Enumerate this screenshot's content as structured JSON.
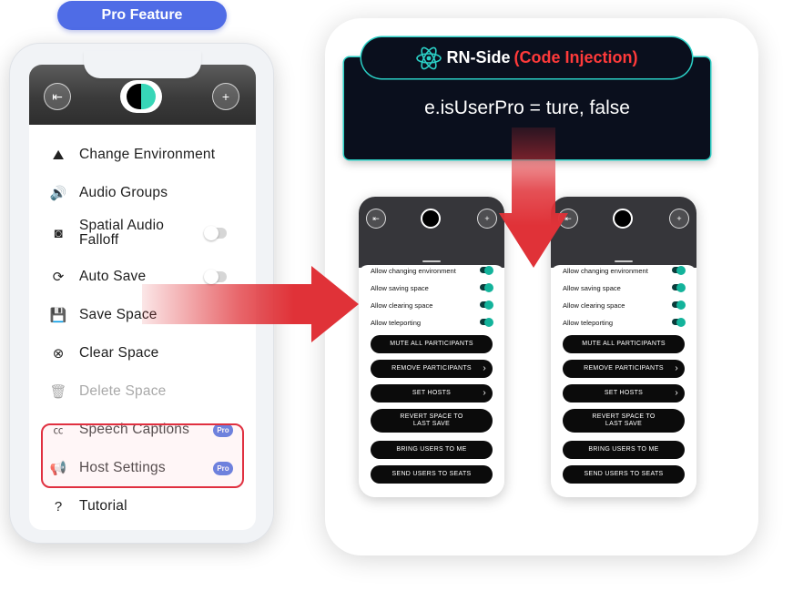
{
  "badge": {
    "label": "Pro Feature"
  },
  "left_phone": {
    "menu": [
      {
        "label": "Change Environment",
        "icon": "mountain-icon",
        "disabled": false
      },
      {
        "label": "Audio Groups",
        "icon": "speaker-icon",
        "disabled": false
      },
      {
        "label": "Spatial Audio Falloff",
        "icon": "spatial-audio-icon",
        "disabled": false,
        "toggle": "off"
      },
      {
        "label": "Auto Save",
        "icon": "auto-save-icon",
        "disabled": false,
        "toggle": "off"
      },
      {
        "label": "Save Space",
        "icon": "floppy-icon",
        "disabled": false
      },
      {
        "label": "Clear Space",
        "icon": "clear-circle-icon",
        "disabled": false
      },
      {
        "label": "Delete Space",
        "icon": "trash-icon",
        "disabled": true
      },
      {
        "label": "Speech Captions",
        "icon": "captions-icon",
        "disabled": false,
        "pro": "Pro"
      },
      {
        "label": "Host Settings",
        "icon": "megaphone-icon",
        "disabled": false,
        "pro": "Pro"
      },
      {
        "label": "Tutorial",
        "icon": "help-icon",
        "disabled": false
      }
    ]
  },
  "code_panel": {
    "title": "RN-Side",
    "subtitle": "(Code Injection)",
    "code": "e.isUserPro = ture, false"
  },
  "mini_phone": {
    "settings": [
      "Allow changing environment",
      "Allow saving space",
      "Allow clearing space",
      "Allow teleporting"
    ],
    "actions": [
      "MUTE ALL PARTICIPANTS",
      "REMOVE PARTICIPANTS",
      "SET HOSTS",
      "REVERT SPACE TO LAST SAVE",
      "BRING USERS TO ME",
      "SEND USERS TO SEATS"
    ]
  },
  "colors": {
    "pro_badge": "#4f6ce6",
    "highlight": "#e03040",
    "arrow": "#e03238",
    "code_bg": "#0a0f1d",
    "code_outline": "#2bd0c6",
    "subtitle_red": "#ff3a3a"
  }
}
